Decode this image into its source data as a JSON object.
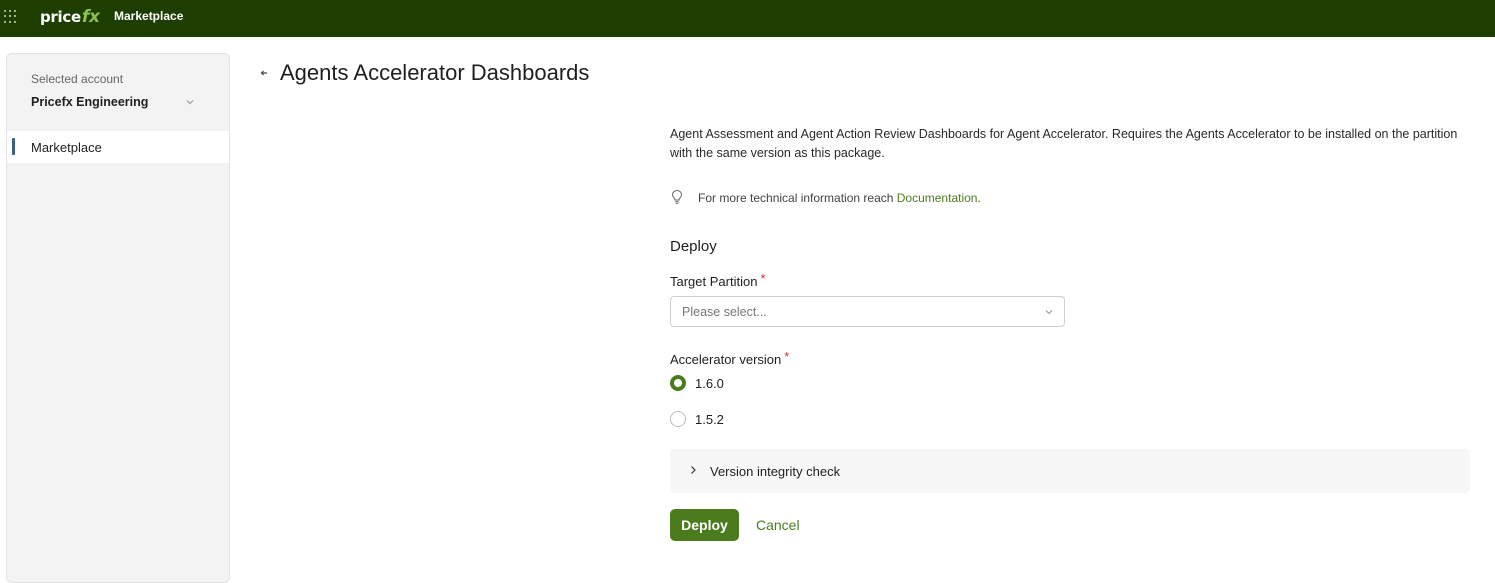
{
  "topbar": {
    "logo_main": "price",
    "logo_fx": "fx",
    "app_name": "Marketplace"
  },
  "sidebar": {
    "account_label": "Selected account",
    "account_name": "Pricefx Engineering",
    "items": [
      {
        "label": "Marketplace",
        "active": true
      }
    ]
  },
  "page": {
    "title": "Agents Accelerator Dashboards",
    "description": "Agent Assessment and Agent Action Review Dashboards for Agent Accelerator. Requires the Agents Accelerator to be installed on the partition with the same version as this package.",
    "tip_text": "For more technical information reach ",
    "tip_link": "Documentation",
    "tip_suffix": "."
  },
  "deploy": {
    "heading": "Deploy",
    "target_partition_label": "Target Partition",
    "target_partition_placeholder": "Please select...",
    "required_mark": "*",
    "version_label": "Accelerator version",
    "versions": [
      {
        "label": "1.6.0",
        "selected": true
      },
      {
        "label": "1.5.2",
        "selected": false
      }
    ],
    "integrity_label": "Version integrity check",
    "deploy_button": "Deploy",
    "cancel_button": "Cancel"
  },
  "colors": {
    "topbar": "#1e3d00",
    "accent": "#4a7c1e",
    "required": "#d32f2f"
  }
}
